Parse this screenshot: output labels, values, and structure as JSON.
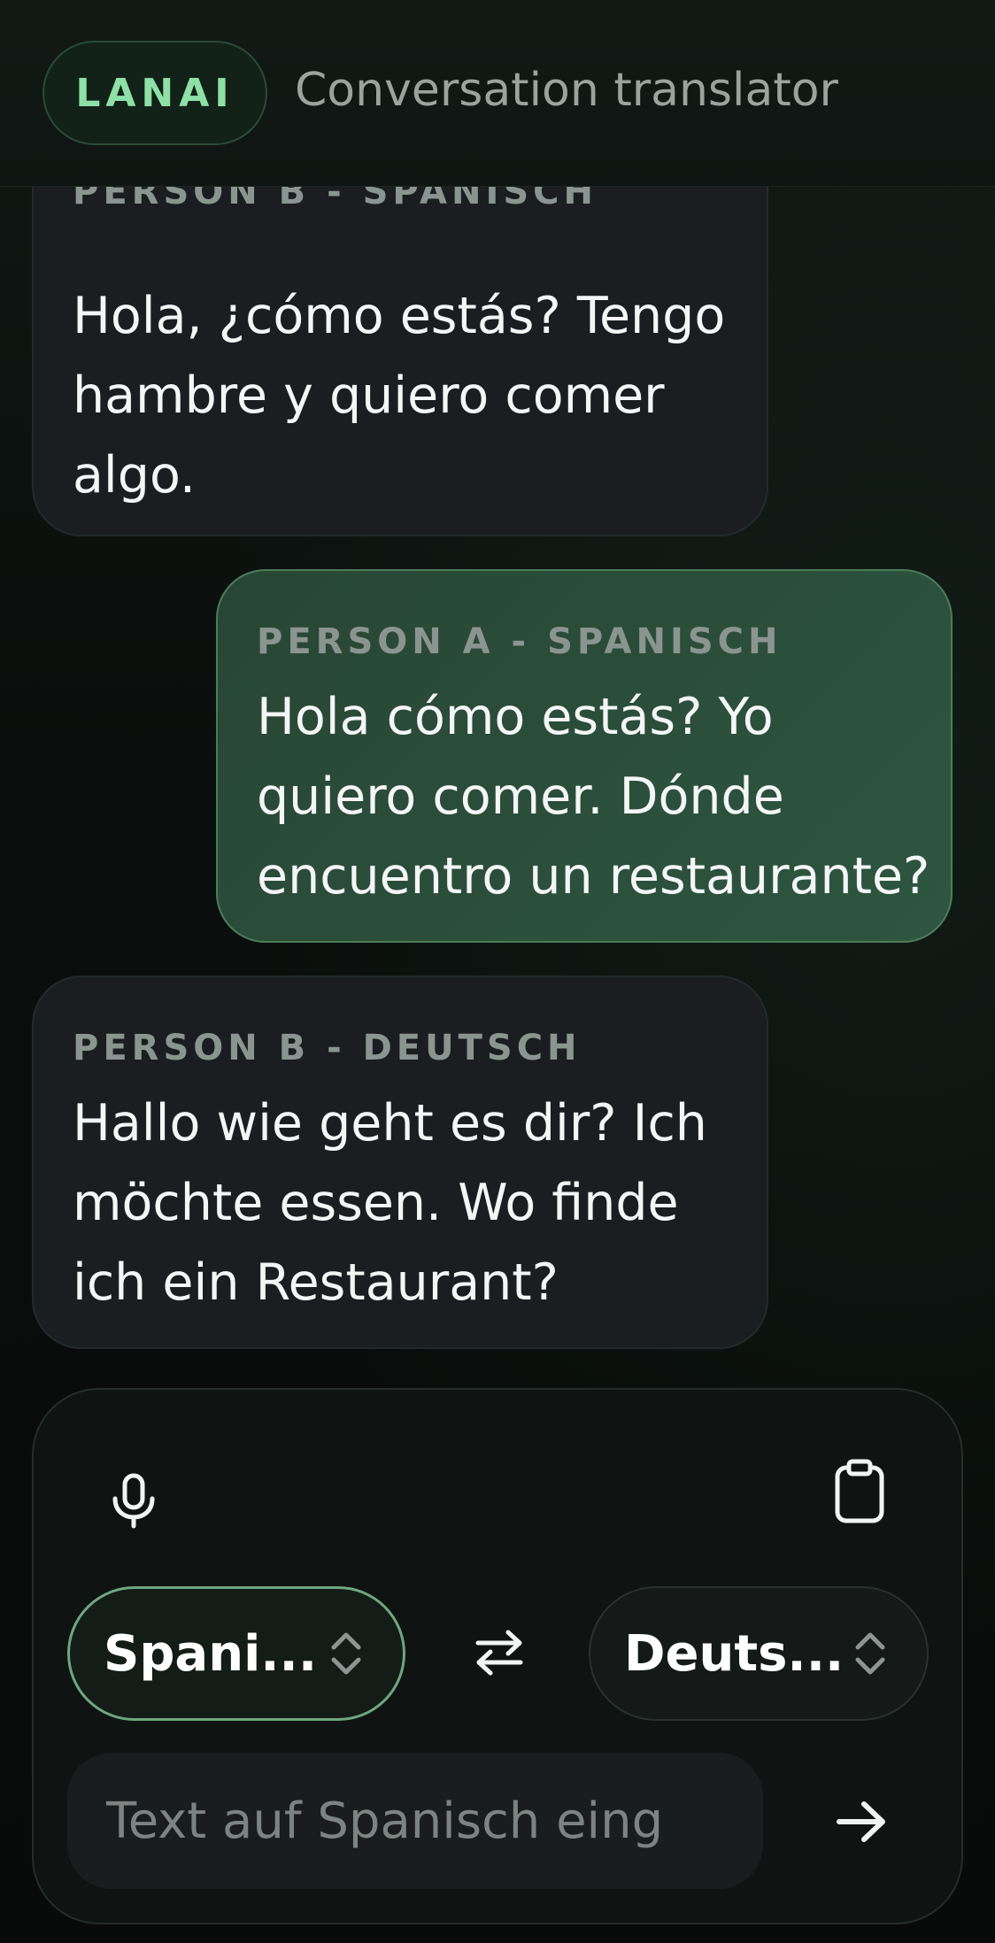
{
  "header": {
    "brand": "LANAI",
    "subtitle": "Conversation translator"
  },
  "messages": [
    {
      "label": "PERSON B - SPANISCH",
      "lines": [
        "Hola, ¿cómo estás? Tengo",
        "hambre y quiero comer",
        "algo."
      ]
    },
    {
      "label": "PERSON A - SPANISCH",
      "lines": [
        "Hola cómo estás? Yo",
        "quiero comer. Dónde",
        "encuentro un restaurante?"
      ]
    },
    {
      "label": "PERSON B - DEUTSCH",
      "lines": [
        "Hallo wie geht es dir? Ich",
        "möchte essen. Wo finde",
        "ich ein Restaurant?"
      ]
    }
  ],
  "composer": {
    "mic_icon": "microphone-icon",
    "clipboard_icon": "clipboard-icon",
    "source_language": "Spani...",
    "target_language": "Deuts...",
    "swap_icon": "swap-arrows-icon",
    "input_placeholder": "Text auf Spanisch eing",
    "send_icon": "arrow-right-icon"
  },
  "colors": {
    "accent": "#8ee0a7",
    "outgoing_bubble": "#2d5640",
    "incoming_bubble": "#1a1e21"
  }
}
